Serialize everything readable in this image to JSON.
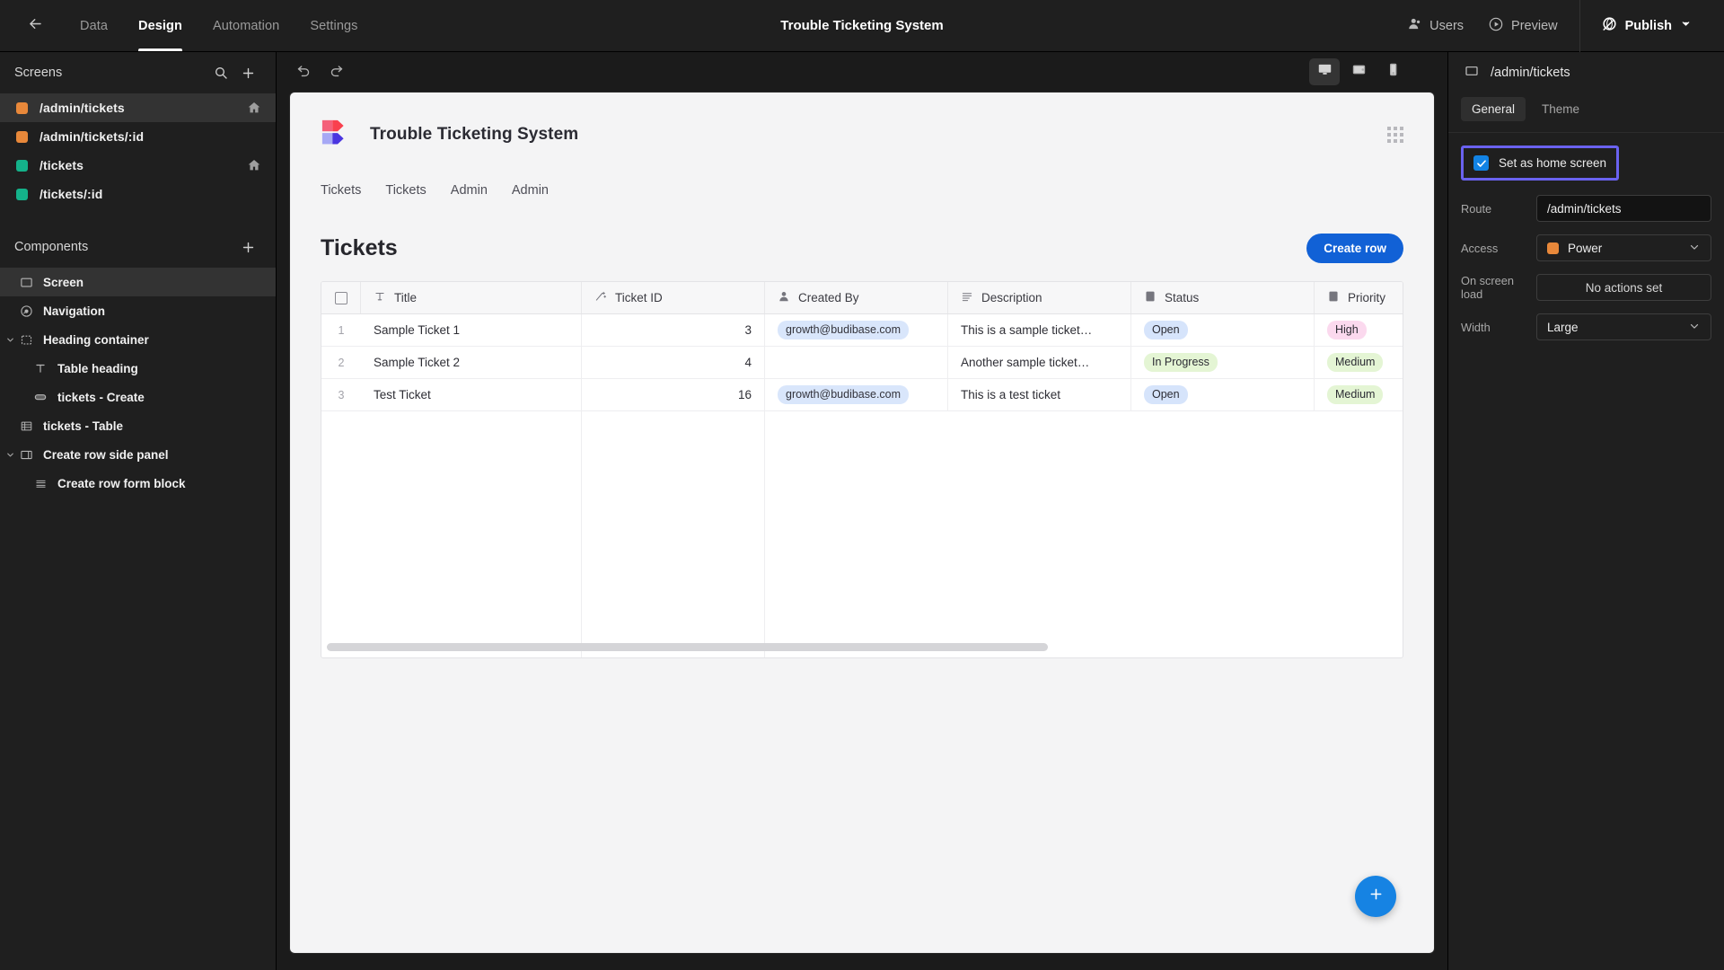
{
  "topbar": {
    "back_icon": "arrow-left-icon",
    "tabs": [
      {
        "label": "Data",
        "active": false
      },
      {
        "label": "Design",
        "active": true
      },
      {
        "label": "Automation",
        "active": false
      },
      {
        "label": "Settings",
        "active": false
      }
    ],
    "app_title": "Trouble Ticketing System",
    "users_label": "Users",
    "preview_label": "Preview",
    "publish_label": "Publish"
  },
  "sidebar": {
    "screens_title": "Screens",
    "search_icon": "search-icon",
    "add_icon": "plus-icon",
    "screens": [
      {
        "label": "/admin/tickets",
        "color": "#e8883a",
        "home": true,
        "selected": true
      },
      {
        "label": "/admin/tickets/:id",
        "color": "#e8883a",
        "home": false,
        "selected": false
      },
      {
        "label": "/tickets",
        "color": "#14b28a",
        "home": true,
        "selected": false
      },
      {
        "label": "/tickets/:id",
        "color": "#14b28a",
        "home": false,
        "selected": false
      }
    ],
    "components_title": "Components",
    "components_add_icon": "plus-icon",
    "components": [
      {
        "label": "Screen",
        "icon": "screen-icon",
        "indent": 0,
        "caret": false,
        "selected": true
      },
      {
        "label": "Navigation",
        "icon": "navigation-icon",
        "indent": 0,
        "caret": false,
        "selected": false
      },
      {
        "label": "Heading container",
        "icon": "container-icon",
        "indent": 0,
        "caret": true,
        "selected": false
      },
      {
        "label": "Table heading",
        "icon": "text-icon",
        "indent": 1,
        "caret": false,
        "selected": false
      },
      {
        "label": "tickets - Create",
        "icon": "button-icon",
        "indent": 1,
        "caret": false,
        "selected": false
      },
      {
        "label": "tickets - Table",
        "icon": "table-icon",
        "indent": 0,
        "caret": false,
        "selected": false
      },
      {
        "label": "Create row side panel",
        "icon": "side-panel-icon",
        "indent": 0,
        "caret": true,
        "selected": false
      },
      {
        "label": "Create row form block",
        "icon": "form-icon",
        "indent": 1,
        "caret": false,
        "selected": false
      }
    ]
  },
  "canvas": {
    "undo_icon": "undo-icon",
    "redo_icon": "redo-icon",
    "devices": [
      {
        "name": "desktop-view",
        "active": true
      },
      {
        "name": "tablet-view",
        "active": false
      },
      {
        "name": "mobile-view",
        "active": false
      }
    ]
  },
  "app": {
    "brand_name": "Trouble Ticketing System",
    "grid_icon": "app-grid-icon",
    "nav_links": [
      "Tickets",
      "Tickets",
      "Admin",
      "Admin"
    ],
    "heading": "Tickets",
    "create_row_label": "Create row",
    "fab_icon": "plus-icon",
    "table": {
      "columns": [
        {
          "label": "",
          "icon": "checkbox-icon",
          "key": "check"
        },
        {
          "label": "Title",
          "icon": "text-type-icon",
          "key": "title"
        },
        {
          "label": "Ticket ID",
          "icon": "formula-icon",
          "key": "ticket_id"
        },
        {
          "label": "Created By",
          "icon": "user-icon",
          "key": "created_by"
        },
        {
          "label": "Description",
          "icon": "longform-icon",
          "key": "description"
        },
        {
          "label": "Status",
          "icon": "options-icon",
          "key": "status"
        },
        {
          "label": "Priority",
          "icon": "options-icon",
          "key": "priority"
        }
      ],
      "rows": [
        {
          "num": "1",
          "title": "Sample Ticket 1",
          "ticket_id": "3",
          "created_by": "growth@budibase.com",
          "description": "This is a sample ticket…",
          "status": "Open",
          "status_color": "blue",
          "priority": "High",
          "priority_color": "pink"
        },
        {
          "num": "2",
          "title": "Sample Ticket 2",
          "ticket_id": "4",
          "created_by": "",
          "description": "Another sample ticket…",
          "status": "In Progress",
          "status_color": "green",
          "priority": "Medium",
          "priority_color": "green"
        },
        {
          "num": "3",
          "title": "Test Ticket",
          "ticket_id": "16",
          "created_by": "growth@budibase.com",
          "description": "This is a test ticket",
          "status": "Open",
          "status_color": "blue",
          "priority": "Medium",
          "priority_color": "green"
        }
      ]
    }
  },
  "rightpanel": {
    "screen_icon": "screen-icon",
    "title": "/admin/tickets",
    "tabs": [
      {
        "label": "General",
        "active": true
      },
      {
        "label": "Theme",
        "active": false
      }
    ],
    "home_screen_label": "Set as home screen",
    "home_screen_checked": true,
    "highlight_color": "#6a62f0",
    "fields": [
      {
        "label": "Route",
        "value": "/admin/tickets",
        "type": "input"
      },
      {
        "label": "Access",
        "value": "Power",
        "type": "select",
        "dot_color": "#e8883a"
      },
      {
        "label": "On screen load",
        "value": "No actions set",
        "type": "button"
      },
      {
        "label": "Width",
        "value": "Large",
        "type": "select"
      }
    ]
  }
}
